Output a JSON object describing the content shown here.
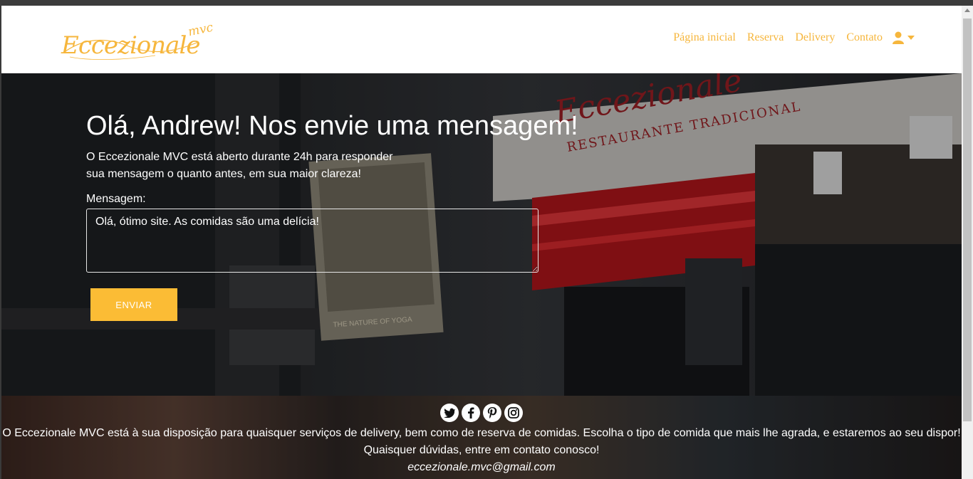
{
  "brand": {
    "name": "Eccezionale",
    "suffix": "mvc"
  },
  "nav": {
    "items": [
      {
        "label": "Página inicial"
      },
      {
        "label": "Reserva"
      },
      {
        "label": "Delivery"
      },
      {
        "label": "Contato"
      }
    ],
    "user_icon": "user-icon",
    "dropdown_icon": "caret-down-icon"
  },
  "hero": {
    "title": "Olá, Andrew! Nos envie uma mensagem!",
    "lead_line1": "O Eccezionale MVC está aberto durante 24h para responder",
    "lead_line2": "sua mensagem o quanto antes, em sua maior clareza!",
    "sign_text": "Eccezionale",
    "sign_subtext": "RESTAURANTE TRADICIONAL",
    "poster_text": "THE NATURE OF YOGA"
  },
  "form": {
    "message_label": "Mensagem:",
    "message_value": "Olá, ótimo site. As comidas são uma delícia!",
    "submit_label": "ENVIAR"
  },
  "footer": {
    "social_icons": [
      "twitter-icon",
      "facebook-icon",
      "pinterest-icon",
      "instagram-icon"
    ],
    "line1": "O Eccezionale MVC está à sua disposição para quaisquer serviços de delivery, bem como de reserva de comidas. Escolha o tipo de comida que mais lhe agrada, e estaremos ao seu dispor!",
    "line2": "Quaisquer dúvidas, entre em contato conosco!",
    "email": "eccezionale.mvc@gmail.com"
  },
  "colors": {
    "accent": "#f6b63c",
    "button": "#fbbc35",
    "navbar_bg": "#ffffff",
    "sign_red": "#9b1f24"
  }
}
